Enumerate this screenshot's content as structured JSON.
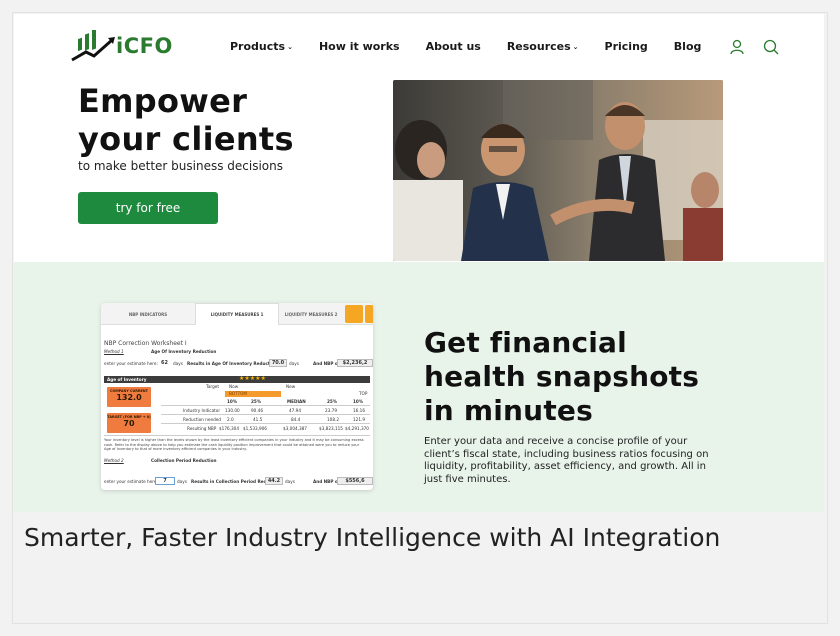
{
  "brand": {
    "name": "iCFO",
    "color": "#2a7b2f"
  },
  "nav": {
    "items": [
      {
        "label": "Products",
        "has_dropdown": true
      },
      {
        "label": "How it works",
        "has_dropdown": false
      },
      {
        "label": "About us",
        "has_dropdown": false
      },
      {
        "label": "Resources",
        "has_dropdown": true
      },
      {
        "label": "Pricing",
        "has_dropdown": false
      },
      {
        "label": "Blog",
        "has_dropdown": false
      }
    ],
    "icons": [
      "user-icon",
      "search-icon"
    ],
    "chevron": "⌄"
  },
  "hero": {
    "title_line1": "Empower",
    "title_line2": "your clients",
    "subtitle": "to make better business decisions",
    "cta_label": "try for free",
    "cta_color": "#1e8a3e"
  },
  "feature": {
    "title_line1": "Get financial",
    "title_line2": "health snapshots",
    "title_line3": "in minutes",
    "description": "Enter your data and receive a concise profile of your client’s fiscal state, including business ratios focusing on liquidity, profitability, asset efficiency, and growth. All in just five minutes.",
    "band_color": "#e8f3ea"
  },
  "worksheet": {
    "tabs": [
      "NBP INDICATORS",
      "LIQUIDITY MEASURES 1",
      "LIQUIDITY MEASURES 2"
    ],
    "heading": "NBP Correction Worksheet I",
    "method1": "Method 1",
    "method1_title": "Age Of Inventory Reduction",
    "estimate_label": "enter your estimate here:",
    "estimate1_value": "62",
    "days": "days",
    "results1_label": "Results in Age Of Inventory Reduction",
    "results1_value": "70.0",
    "nbp_label": "And NBP of",
    "nbp1_value": "$2,236,2",
    "bar1_label": "Age of Inventory",
    "stars": "★★★★★",
    "company_current_label": "COMPANY CURRENT",
    "company_current_value": "132.0",
    "target_label": "TARGET (FOR NBP + 0)",
    "target_value": "70",
    "target_legend": "Target",
    "now_legend": "Now",
    "new_legend": "New",
    "bottom_label": "BOTTOM",
    "top_label": "TOP",
    "col_headers": [
      "10%",
      "25%",
      "MEDIAN",
      "25%",
      "10%"
    ],
    "rows": [
      {
        "label": "Industry Indicator",
        "values": [
          "130.00",
          "90.46",
          "47.94",
          "23.79",
          "16.16"
        ]
      },
      {
        "label": "Reduction needed",
        "values": [
          "2.0",
          "41.5",
          "84.4",
          "108.2",
          "121.9"
        ]
      },
      {
        "label": "Resulting NBP",
        "values": [
          "$176,304",
          "$1,533,906",
          "$3,004,387",
          "$3,823,115",
          "$4,291,370"
        ]
      }
    ],
    "note": "Your inventory level is higher than the levels shown by the least inventory efficient companies in your industry and it may be consuming excess cash. Refer to the display above to help you estimate the cash liquidity position improvement that could be attained were you to reduce your Age of Inventory to that of more inventory efficient companies in your industry.",
    "method2": "Method 2",
    "method2_title": "Collection Period Reduction",
    "estimate2_value": "7",
    "results2_label": "Results in Collection Period Reduction",
    "results2_value": "44.2",
    "nbp2_value": "$556,6"
  },
  "bottom": {
    "heading": "Smarter, Faster Industry Intelligence with AI Integration"
  }
}
